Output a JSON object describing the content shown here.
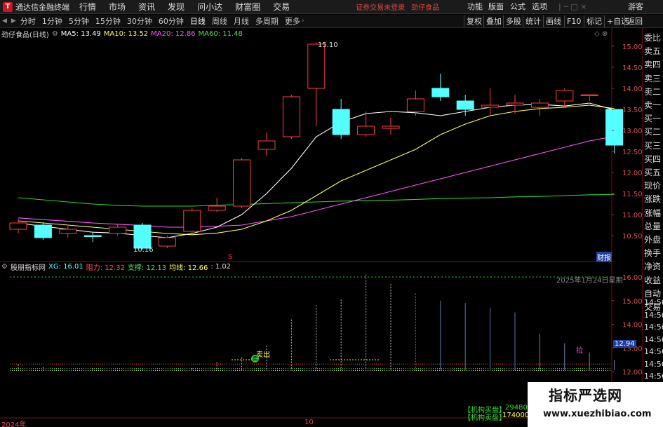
{
  "window": {
    "app_name": "通达信金融终端",
    "menu": [
      "行情",
      "市场",
      "资讯",
      "发现",
      "问小达",
      "财富圈",
      "交易"
    ],
    "notice": "证券交易未登录",
    "notice_stock": "劲仔食品",
    "right_menu": [
      "功能",
      "版面",
      "公式",
      "选项"
    ],
    "guest": "游客"
  },
  "tabs": {
    "items": [
      "分时",
      "1分钟",
      "5分钟",
      "15分钟",
      "30分钟",
      "60分钟",
      "日线",
      "周线",
      "月线",
      "多周期",
      "更多"
    ],
    "active": "日线",
    "buttons": [
      "复权",
      "叠加",
      "多股",
      "统计",
      "画线",
      "F10",
      "标记",
      "+自选",
      "返回"
    ]
  },
  "main_legend": {
    "stock": "劲仔食品(日线)",
    "ma5": "MA5: 13.49",
    "ma10": "MA10: 13.52",
    "ma20": "MA20: 12.86",
    "ma60": "MA60: 11.48"
  },
  "sub_legend": {
    "name": "股朋指标网",
    "xg": "XG: 16.01",
    "resist": "阻力: 12.32",
    "support": "支撑: 12.13",
    "balance": "均线: 12.66",
    "extra": ": 1.02"
  },
  "right_panel": [
    "委比",
    "卖五",
    "卖四",
    "卖三",
    "卖二",
    "卖一",
    "买一",
    "买二",
    "买三",
    "买四",
    "买五",
    "现价",
    "涨跌",
    "涨幅",
    "总量",
    "外盘",
    "换手",
    "净资",
    "收益",
    "自动",
    "交易"
  ],
  "times": [
    "14:56",
    "14:56",
    "14:56",
    "14:56",
    "14:56",
    "14:56",
    "14:56"
  ],
  "annotations": {
    "high": "15.10",
    "low": "10.16",
    "date_label": "2025年1月24日星期",
    "sell": "卖出",
    "pull": "拉",
    "cur_price": "12.94",
    "cai_bao": "财报",
    "s_mark": "S",
    "inst_sell": "【机构卖盘】",
    "inst_sell_val": "174000",
    "inst_buy": "【机构买盘】",
    "inst_buy_val": "294800",
    "year": "2024年",
    "month": "10"
  },
  "watermark": {
    "title": "指标严选网",
    "url": "www.xuezhibiao.com"
  },
  "colors": {
    "up": "#ff4040",
    "down": "#54ffff",
    "ma5": "#ffffff",
    "ma10": "#ffff55",
    "ma20": "#ff55ff",
    "ma60": "#33cc33"
  },
  "chart_data": {
    "type": "candlestick",
    "y_ticks_main": [
      10.5,
      11.0,
      11.5,
      12.0,
      12.5,
      13.0,
      13.5,
      14.0,
      14.5,
      15.0
    ],
    "y_ticks_sub": [
      12.0,
      13.0,
      14.0,
      15.0,
      16.0
    ],
    "candles": [
      {
        "o": 10.65,
        "c": 10.8,
        "h": 10.9,
        "l": 10.55
      },
      {
        "o": 10.75,
        "c": 10.45,
        "h": 10.82,
        "l": 10.4
      },
      {
        "o": 10.55,
        "c": 10.65,
        "h": 10.72,
        "l": 10.45
      },
      {
        "o": 10.5,
        "c": 10.48,
        "h": 10.58,
        "l": 10.35
      },
      {
        "o": 10.55,
        "c": 10.7,
        "h": 10.78,
        "l": 10.5
      },
      {
        "o": 10.75,
        "c": 10.2,
        "h": 10.8,
        "l": 10.16
      },
      {
        "o": 10.25,
        "c": 10.45,
        "h": 10.5,
        "l": 10.2
      },
      {
        "o": 10.6,
        "c": 11.1,
        "h": 11.15,
        "l": 10.55
      },
      {
        "o": 11.1,
        "c": 11.2,
        "h": 11.4,
        "l": 11.05
      },
      {
        "o": 11.2,
        "c": 12.3,
        "h": 12.35,
        "l": 11.15
      },
      {
        "o": 12.55,
        "c": 12.75,
        "h": 12.95,
        "l": 12.4
      },
      {
        "o": 12.85,
        "c": 13.8,
        "h": 13.85,
        "l": 12.8
      },
      {
        "o": 14.0,
        "c": 15.05,
        "h": 15.1,
        "l": 13.1
      },
      {
        "o": 13.5,
        "c": 12.9,
        "h": 13.75,
        "l": 12.8
      },
      {
        "o": 12.9,
        "c": 13.1,
        "h": 13.45,
        "l": 12.85
      },
      {
        "o": 13.05,
        "c": 13.1,
        "h": 13.3,
        "l": 12.9
      },
      {
        "o": 13.45,
        "c": 13.75,
        "h": 13.95,
        "l": 13.35
      },
      {
        "o": 14.0,
        "c": 13.8,
        "h": 14.35,
        "l": 13.7
      },
      {
        "o": 13.7,
        "c": 13.5,
        "h": 13.85,
        "l": 13.35
      },
      {
        "o": 13.55,
        "c": 13.6,
        "h": 14.0,
        "l": 13.35
      },
      {
        "o": 13.6,
        "c": 13.65,
        "h": 13.85,
        "l": 13.4
      },
      {
        "o": 13.55,
        "c": 13.65,
        "h": 13.75,
        "l": 13.35
      },
      {
        "o": 13.7,
        "c": 13.95,
        "h": 14.0,
        "l": 13.55
      },
      {
        "o": 13.85,
        "c": 13.85,
        "h": 13.85,
        "l": 13.7
      },
      {
        "o": 13.5,
        "c": 12.65,
        "h": 13.5,
        "l": 12.45
      }
    ],
    "ma5": [
      10.8,
      10.72,
      10.65,
      10.58,
      10.56,
      10.5,
      10.45,
      10.55,
      10.7,
      11.0,
      11.5,
      12.1,
      12.85,
      13.2,
      13.4,
      13.45,
      13.42,
      13.35,
      13.45,
      13.55,
      13.6,
      13.62,
      13.58,
      13.65,
      13.49
    ],
    "ma10": [
      10.85,
      10.8,
      10.75,
      10.7,
      10.65,
      10.6,
      10.55,
      10.52,
      10.56,
      10.65,
      10.85,
      11.1,
      11.45,
      11.8,
      12.05,
      12.3,
      12.55,
      12.9,
      13.15,
      13.35,
      13.45,
      13.52,
      13.55,
      13.6,
      13.52
    ],
    "ma20": [
      10.92,
      10.88,
      10.84,
      10.8,
      10.77,
      10.74,
      10.7,
      10.7,
      10.72,
      10.75,
      10.85,
      10.95,
      11.1,
      11.25,
      11.4,
      11.55,
      11.7,
      11.85,
      12.0,
      12.15,
      12.3,
      12.45,
      12.6,
      12.75,
      12.86
    ],
    "ma60": [
      11.4,
      11.35,
      11.3,
      11.25,
      11.22,
      11.2,
      11.2,
      11.2,
      11.22,
      11.24,
      11.26,
      11.28,
      11.3,
      11.32,
      11.33,
      11.34,
      11.36,
      11.38,
      11.39,
      11.4,
      11.42,
      11.43,
      11.45,
      11.47,
      11.48
    ],
    "sub_spikes": [
      {
        "x": 0,
        "v": 12.3
      },
      {
        "x": 1,
        "v": 12.2
      },
      {
        "x": 3,
        "v": 12.15
      },
      {
        "x": 5,
        "v": 12.1
      },
      {
        "x": 7,
        "v": 12.15
      },
      {
        "x": 8,
        "v": 12.4
      },
      {
        "x": 9,
        "v": 12.6
      },
      {
        "x": 10,
        "v": 13.1
      },
      {
        "x": 11,
        "v": 14.2
      },
      {
        "x": 12,
        "v": 14.8
      },
      {
        "x": 13,
        "v": 15.05
      },
      {
        "x": 14,
        "v": 16.1
      },
      {
        "x": 15,
        "v": 15.7
      },
      {
        "x": 16,
        "v": 15.3
      },
      {
        "x": 17,
        "v": 15.0
      },
      {
        "x": 18,
        "v": 14.9
      },
      {
        "x": 19,
        "v": 14.7
      },
      {
        "x": 20,
        "v": 14.5
      },
      {
        "x": 21,
        "v": 13.6
      },
      {
        "x": 22,
        "v": 13.2
      },
      {
        "x": 23,
        "v": 12.8
      },
      {
        "x": 24,
        "v": 12.5
      }
    ]
  }
}
